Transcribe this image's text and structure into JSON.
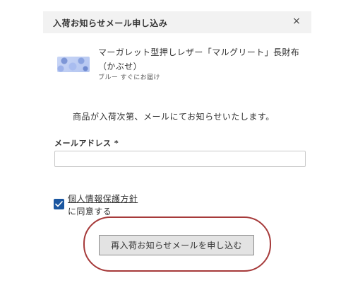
{
  "modal": {
    "title": "入荷お知らせメール申し込み",
    "close_icon": "×"
  },
  "product": {
    "name": "マーガレット型押しレザー「マルグリート」長財布（かぶせ）",
    "variant": "ブルー すぐにお届け",
    "thumbnail_icon": "product-thumbnail"
  },
  "description": "商品が入荷次第、メールにてお知らせいたします。",
  "email": {
    "label": "メールアドレス *",
    "value": "",
    "placeholder": ""
  },
  "consent": {
    "checked": true,
    "link_text": "個人情報保護方針",
    "agree_text": "に同意する",
    "checkbox_color": "#1a56a0"
  },
  "submit": {
    "label": "再入荷お知らせメールを申し込む"
  },
  "colors": {
    "header_bg": "#f2f2f2",
    "highlight_ring": "#a63a3a",
    "button_bg": "#e3e3e3"
  }
}
